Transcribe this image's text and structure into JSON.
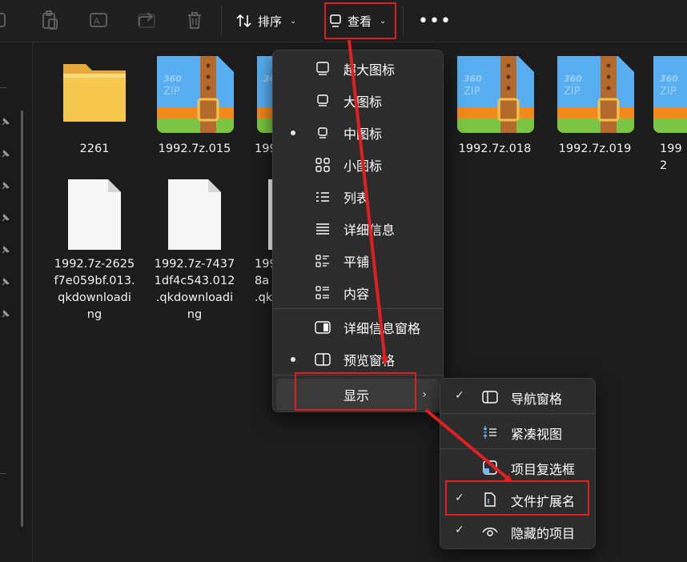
{
  "toolbar": {
    "sort_label": "排序",
    "view_label": "查看",
    "more_label": "•••"
  },
  "files": {
    "row1": [
      {
        "name": "2261",
        "type": "folder"
      },
      {
        "name": "1992.7z.015",
        "type": "zip"
      },
      {
        "name": "199",
        "type": "zip"
      },
      {
        "name": "1992.7z.018",
        "type": "zip"
      },
      {
        "name": "1992.7z.019",
        "type": "zip"
      },
      {
        "name": "1992",
        "type": "zip"
      }
    ],
    "row2": [
      {
        "name_lines": [
          "1992.7z-2625",
          "f7e059bf.013.",
          "qkdownloadi",
          "ng"
        ]
      },
      {
        "name_lines": [
          "1992.7z-7437",
          "1df4c543.012",
          ".qkdownloadi",
          "ng"
        ]
      },
      {
        "name_lines": [
          "199",
          "8a",
          ".qk"
        ]
      }
    ],
    "zip_badge": "360",
    "zip_word": "ZIP"
  },
  "view_menu": {
    "items": [
      {
        "label": "超大图标",
        "icon": "extra-large-icons-icon",
        "selected": false
      },
      {
        "label": "大图标",
        "icon": "large-icons-icon",
        "selected": false
      },
      {
        "label": "中图标",
        "icon": "medium-icons-icon",
        "selected": true
      },
      {
        "label": "小图标",
        "icon": "small-icons-icon",
        "selected": false
      },
      {
        "label": "列表",
        "icon": "list-icon",
        "selected": false
      },
      {
        "label": "详细信息",
        "icon": "details-icon",
        "selected": false
      },
      {
        "label": "平铺",
        "icon": "tiles-icon",
        "selected": false
      },
      {
        "label": "内容",
        "icon": "content-icon",
        "selected": false
      },
      {
        "label": "详细信息窗格",
        "icon": "details-pane-icon",
        "selected": false
      },
      {
        "label": "预览窗格",
        "icon": "preview-pane-icon",
        "selected": true
      },
      {
        "label": "显示",
        "icon": "",
        "selected": false,
        "has_submenu": true
      }
    ]
  },
  "show_submenu": {
    "items": [
      {
        "label": "导航窗格",
        "checked": true,
        "icon": "navigation-pane-icon"
      },
      {
        "label": "紧凑视图",
        "checked": false,
        "icon": "compact-view-icon"
      },
      {
        "label": "项目复选框",
        "checked": false,
        "icon": "item-checkbox-icon"
      },
      {
        "label": "文件扩展名",
        "checked": true,
        "icon": "file-extension-icon"
      },
      {
        "label": "隐藏的项目",
        "checked": true,
        "icon": "hidden-items-icon"
      }
    ],
    "check_mark": "✓"
  },
  "colors": {
    "annotation_red": "#e02020",
    "menu_bg": "#2c2c2c",
    "folder_yellow": "#f6c94e",
    "zip_blue": "#57aef0",
    "zip_orange": "#f08a1c",
    "zip_green": "#7cc443",
    "zip_strap": "#b36a2c"
  }
}
